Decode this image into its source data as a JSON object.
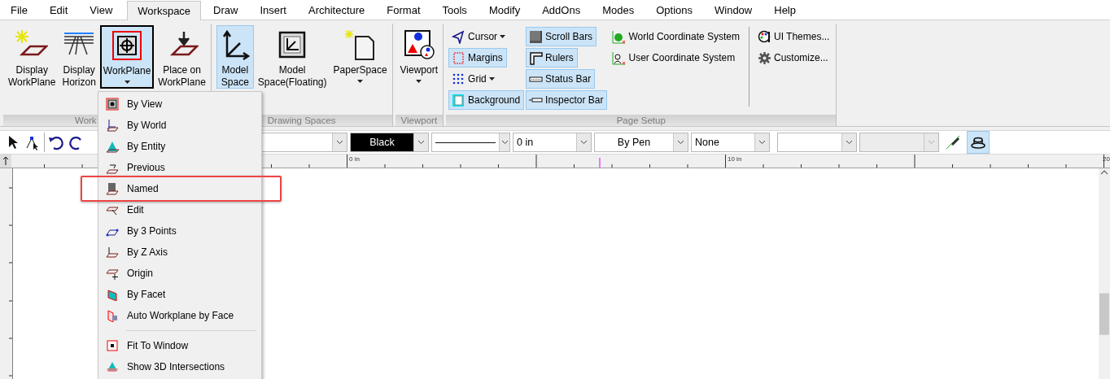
{
  "menu_bar": [
    {
      "label": "File",
      "selected": false
    },
    {
      "label": "Edit",
      "selected": false
    },
    {
      "label": "View",
      "selected": false
    },
    {
      "label": "Workspace",
      "selected": true
    },
    {
      "label": "Draw",
      "selected": false
    },
    {
      "label": "Insert",
      "selected": false
    },
    {
      "label": "Architecture",
      "selected": false
    },
    {
      "label": "Format",
      "selected": false
    },
    {
      "label": "Tools",
      "selected": false
    },
    {
      "label": "Modify",
      "selected": false
    },
    {
      "label": "AddOns",
      "selected": false
    },
    {
      "label": "Modes",
      "selected": false
    },
    {
      "label": "Options",
      "selected": false
    },
    {
      "label": "Window",
      "selected": false
    },
    {
      "label": "Help",
      "selected": false
    }
  ],
  "ribbon": {
    "groups": [
      {
        "kind": "large",
        "label": "Work",
        "buttons": [
          {
            "lines": [
              "Display",
              "WorkPlane"
            ],
            "selected": false,
            "dropdown": false
          },
          {
            "lines": [
              "Display",
              "Horizon"
            ],
            "selected": false,
            "dropdown": false
          },
          {
            "lines": [
              "WorkPlane"
            ],
            "selected": true,
            "dropdown": true
          },
          {
            "lines": [
              "Place on",
              "WorkPlane"
            ],
            "selected": false,
            "dropdown": false
          }
        ]
      },
      {
        "kind": "large",
        "label": "Drawing Spaces",
        "buttons": [
          {
            "lines": [
              "Model",
              "Space"
            ],
            "selected": true,
            "dropdown": false
          },
          {
            "lines": [
              "Model",
              "Space(Floating)"
            ],
            "selected": false,
            "dropdown": false
          },
          {
            "lines": [
              "PaperSpace"
            ],
            "selected": false,
            "dropdown": true
          }
        ]
      },
      {
        "kind": "large",
        "label": "Viewport",
        "buttons": [
          {
            "lines": [
              "Viewport"
            ],
            "selected": false,
            "dropdown": true
          }
        ]
      },
      {
        "kind": "small",
        "label": "Page Setup",
        "columns": [
          [
            {
              "label": "Cursor",
              "selected": false,
              "dropdown": true
            },
            {
              "label": "Margins",
              "selected": true,
              "dropdown": false
            },
            {
              "label": "Grid",
              "selected": false,
              "dropdown": true
            },
            {
              "label": "Background",
              "selected": true,
              "dropdown": false
            }
          ],
          [
            {
              "label": "Scroll Bars",
              "selected": true,
              "dropdown": false
            },
            {
              "label": "Rulers",
              "selected": true,
              "dropdown": false
            },
            {
              "label": "Status Bar",
              "selected": true,
              "dropdown": false
            },
            {
              "label": "Inspector Bar",
              "selected": true,
              "dropdown": false
            }
          ],
          [
            {
              "label": "World Coordinate System",
              "selected": false,
              "dropdown": false
            },
            {
              "label": "User Coordinate System",
              "selected": false,
              "dropdown": false
            }
          ],
          [
            {
              "label": "UI Themes...",
              "selected": false,
              "dropdown": false
            },
            {
              "label": "Customize...",
              "selected": false,
              "dropdown": false
            }
          ]
        ]
      }
    ]
  },
  "toolbar": {
    "combos": [
      {
        "kind": "text"
      },
      {
        "kind": "color",
        "value": "Black"
      },
      {
        "kind": "line"
      },
      {
        "kind": "text",
        "value": "0 in"
      },
      {
        "kind": "text",
        "value": "By Pen"
      },
      {
        "kind": "text",
        "value": "None"
      },
      {
        "kind": "text"
      },
      {
        "kind": "disabled"
      }
    ],
    "toggles": [
      {
        "selected": false
      },
      {
        "selected": true
      }
    ]
  },
  "ruler": {
    "labels": [
      "0 in",
      "10 in",
      "20"
    ]
  },
  "workplane_menu": {
    "items": [
      {
        "kind": "item",
        "label": "By View",
        "highlighted": false
      },
      {
        "kind": "item",
        "label": "By World",
        "highlighted": false
      },
      {
        "kind": "item",
        "label": "By Entity",
        "highlighted": false
      },
      {
        "kind": "item",
        "label": "Previous",
        "highlighted": false
      },
      {
        "kind": "item",
        "label": "Named",
        "highlighted": true
      },
      {
        "kind": "item",
        "label": "Edit",
        "highlighted": false
      },
      {
        "kind": "item",
        "label": "By 3 Points",
        "highlighted": false
      },
      {
        "kind": "item",
        "label": "By Z Axis",
        "highlighted": false
      },
      {
        "kind": "item",
        "label": "Origin",
        "highlighted": false
      },
      {
        "kind": "item",
        "label": "By Facet",
        "highlighted": false
      },
      {
        "kind": "item",
        "label": "Auto Workplane by Face",
        "highlighted": false
      },
      {
        "kind": "separator"
      },
      {
        "kind": "item",
        "label": "Fit To Window",
        "highlighted": false
      },
      {
        "kind": "item",
        "label": "Show 3D Intersections",
        "highlighted": false
      }
    ]
  }
}
